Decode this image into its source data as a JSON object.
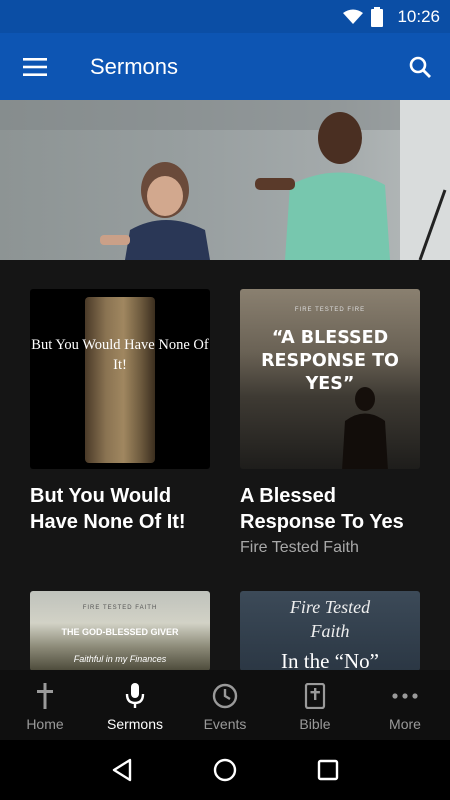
{
  "status_bar": {
    "time": "10:26"
  },
  "app_bar": {
    "title": "Sermons"
  },
  "sermons": [
    {
      "title": "But You Would Have None Of It!",
      "thumb_text": "But You Would Have None Of It!",
      "subtitle": ""
    },
    {
      "title": "A Blessed Response To Yes",
      "thumb_series": "FIRE TESTED FIRE",
      "thumb_text": "“A BLESSED RESPONSE TO YES”",
      "subtitle": "Fire Tested Faith"
    },
    {
      "thumb_series": "FIRE TESTED FAITH",
      "thumb_text": "THE GOD-BLESSED GIVER",
      "thumb_sub": "Faithful in my Finances"
    },
    {
      "thumb_line1": "Fire Tested",
      "thumb_line2": "Faith",
      "thumb_line3": "In the “No”"
    }
  ],
  "bottom_nav": [
    {
      "label": "Home",
      "icon": "cross-icon"
    },
    {
      "label": "Sermons",
      "icon": "microphone-icon",
      "active": true
    },
    {
      "label": "Events",
      "icon": "clock-icon"
    },
    {
      "label": "Bible",
      "icon": "bible-icon"
    },
    {
      "label": "More",
      "icon": "more-icon"
    }
  ],
  "colors": {
    "app_bar": "#0d55b3",
    "status_bar": "#0b4ea5",
    "background": "#151515"
  }
}
